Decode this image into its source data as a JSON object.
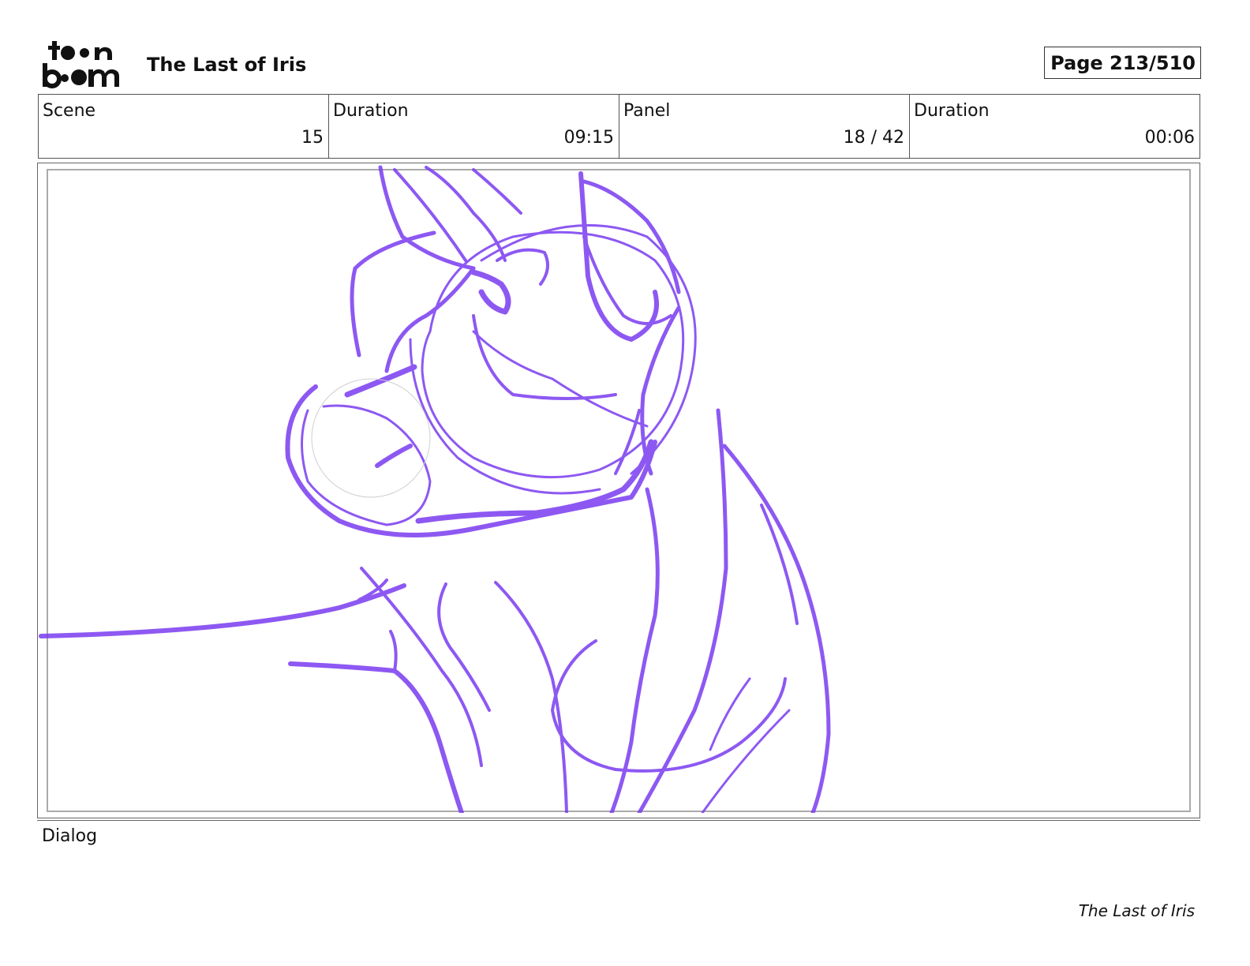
{
  "header": {
    "logo_text_top": "toon",
    "logo_text_bottom": "boom",
    "project_title": "The Last of Iris",
    "page_label": "Page 213/510"
  },
  "info": {
    "scene_label": "Scene",
    "scene_value": "15",
    "scene_duration_label": "Duration",
    "scene_duration_value": "09:15",
    "panel_label": "Panel",
    "panel_value": "18 / 42",
    "panel_duration_label": "Duration",
    "panel_duration_value": "00:06"
  },
  "panel": {
    "sketch_color": "#7a3cf0",
    "sketch_subject": "cat-head-sketch"
  },
  "dialog": {
    "label": "Dialog"
  },
  "footer": {
    "title": "The Last of Iris"
  }
}
